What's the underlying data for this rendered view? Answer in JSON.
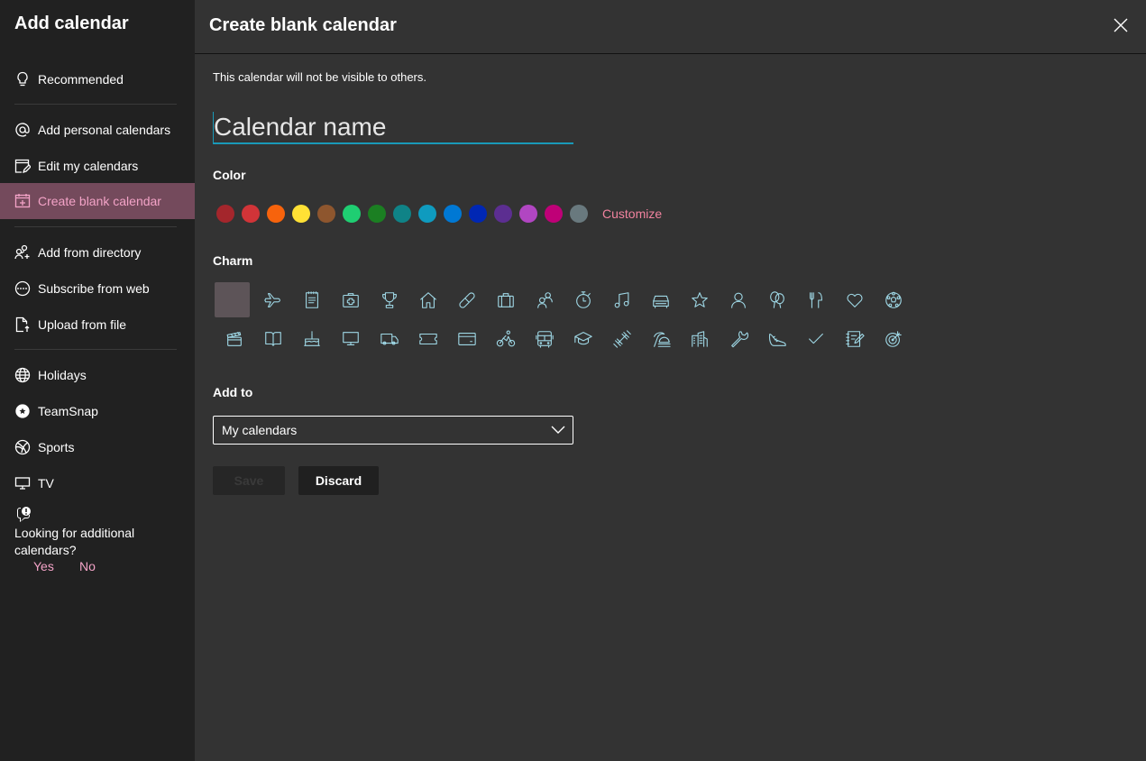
{
  "sidebar": {
    "title": "Add calendar",
    "items": [
      {
        "label": "Recommended",
        "icon": "lightbulb-icon"
      },
      {
        "label": "Add personal calendars",
        "icon": "at-sign-icon"
      },
      {
        "label": "Edit my calendars",
        "icon": "edit-calendar-icon"
      },
      {
        "label": "Create blank calendar",
        "icon": "calendar-add-icon",
        "active": true
      },
      {
        "label": "Add from directory",
        "icon": "people-add-icon"
      },
      {
        "label": "Subscribe from web",
        "icon": "web-subscribe-icon"
      },
      {
        "label": "Upload from file",
        "icon": "file-upload-icon"
      },
      {
        "label": "Holidays",
        "icon": "globe-icon"
      },
      {
        "label": "TeamSnap",
        "icon": "teamsnap-icon"
      },
      {
        "label": "Sports",
        "icon": "sports-ball-icon"
      },
      {
        "label": "TV",
        "icon": "tv-icon"
      }
    ],
    "feedback": {
      "question": "Looking for additional calendars?",
      "yes_label": "Yes",
      "no_label": "No"
    }
  },
  "panel": {
    "title": "Create blank calendar",
    "close_icon": "close-icon",
    "info_text": "This calendar will not be visible to others.",
    "name_input": {
      "value": "",
      "placeholder": "Calendar name"
    },
    "color_label": "Color",
    "colors": [
      "#a4262c",
      "#d13438",
      "#f7630c",
      "#ffe135",
      "#8e562e",
      "#1fce72",
      "#1b7f22",
      "#0f8387",
      "#0f9bbf",
      "#0078d4",
      "#0027b4",
      "#5c2e91",
      "#b146c2",
      "#bf0077",
      "#69797e"
    ],
    "customize_label": "Customize",
    "charm_label": "Charm",
    "charms_row1": [
      "blank",
      "airplane",
      "notepad",
      "medical-kit",
      "trophy",
      "home",
      "bandage",
      "briefcase",
      "people",
      "stopwatch",
      "music-note",
      "car",
      "star",
      "person",
      "balloons",
      "fork-knife",
      "heart",
      "soccer-ball"
    ],
    "charms_row2": [
      "clapperboard",
      "book",
      "birthday-cake",
      "monitor",
      "truck",
      "ticket",
      "credit-card",
      "cyclist",
      "bus",
      "graduation-cap",
      "dumbbell",
      "beach-umbrella",
      "city-buildings",
      "wrench",
      "sneaker",
      "checkmark",
      "edit-notes",
      "target"
    ],
    "add_to_label": "Add to",
    "add_to_selected": "My calendars",
    "save_label": "Save",
    "discard_label": "Discard"
  }
}
